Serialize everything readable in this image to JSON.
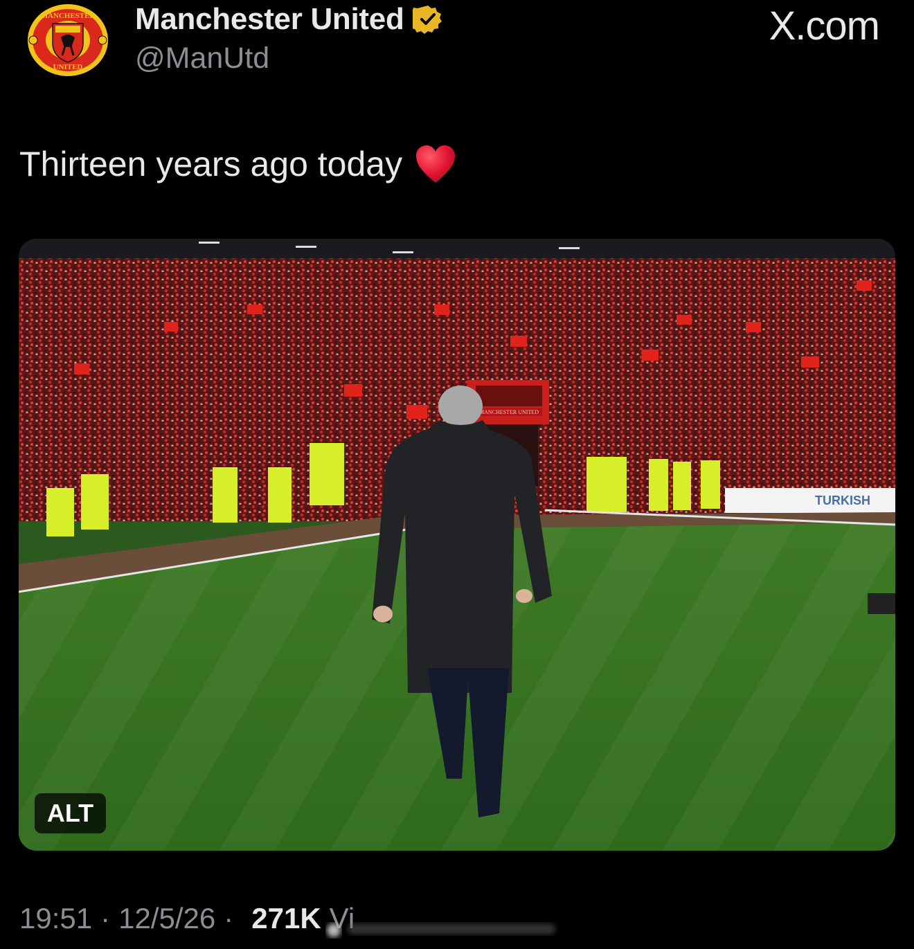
{
  "account": {
    "display_name": "Manchester United",
    "handle": "@ManUtd",
    "verified": true,
    "verified_color": "#e8b626",
    "logo_text_top": "MANCHESTER",
    "logo_text_bottom": "UNITED"
  },
  "site_mark": "X.com",
  "tweet": {
    "text": "Thirteen years ago today",
    "emoji": "heart-icon"
  },
  "media": {
    "alt_badge": "ALT",
    "tunnel_sign": "MANCHESTER UNITED",
    "ad_board": "TURKISH"
  },
  "meta": {
    "time": "19:51",
    "date": "12/5/26",
    "views_count": "271K",
    "views_label": "Vi"
  },
  "colors": {
    "background": "#000000",
    "text_primary": "#e7e9ea",
    "text_secondary": "#8b8f94",
    "heart_red": "#e0142f",
    "club_red": "#da291c"
  }
}
